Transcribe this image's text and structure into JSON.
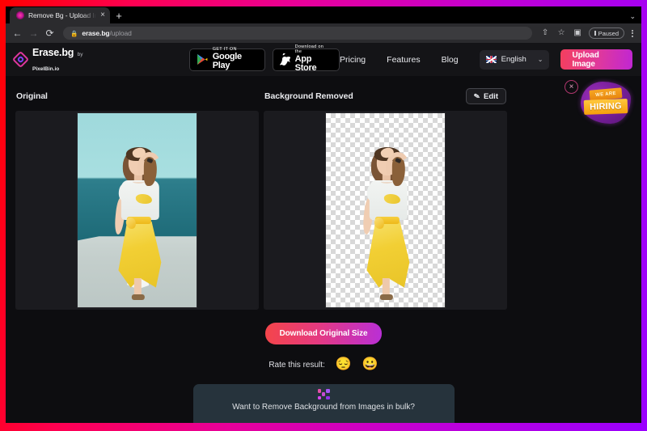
{
  "browser": {
    "tab": {
      "title": "Remove Bg - Upload Images to",
      "close_label": "×"
    },
    "new_tab_label": "+",
    "window_caret": "⌄",
    "back_label": "←",
    "forward_label": "→",
    "reload_label": "⟳",
    "lock_label": "🔒",
    "url_domain": "erase.bg",
    "url_path": "/upload",
    "share_label": "⇧",
    "bookmark_label": "☆",
    "sidepanel_label": "▣",
    "paused_label": "Paused",
    "menu_label": "kebab-menu"
  },
  "header": {
    "logo": {
      "name": "Erase.bg",
      "byline_prefix": "by ",
      "byline_brand": "PixelBin.io"
    },
    "store_badges": [
      {
        "small": "GET IT ON",
        "big": "Google Play",
        "icon": "google-play-icon"
      },
      {
        "small": "Download on the",
        "big": "App Store",
        "icon": "apple-icon"
      }
    ],
    "nav_links": [
      "Pricing",
      "Features",
      "Blog"
    ],
    "language": {
      "value": "English",
      "flag": "uk-flag",
      "chevron": "⌄"
    },
    "upload_button": "Upload Image"
  },
  "promo": {
    "close_label": "×",
    "hiring_top": "WE ARE",
    "hiring_main": "HIRING"
  },
  "panels": [
    {
      "title": "Original",
      "has_edit": false,
      "edit_label": ""
    },
    {
      "title": "Background Removed",
      "has_edit": true,
      "edit_label": "Edit"
    }
  ],
  "actions": {
    "download_label": "Download Original Size",
    "rate_label": "Rate this result:",
    "rate_negative": "😔",
    "rate_positive": "😀"
  },
  "bulk_banner": {
    "text": "Want to Remove Background from Images in bulk?",
    "icon": "bulk-dots-icon"
  },
  "colors": {
    "accent_pink": "#e0399b",
    "accent_purple": "#c026d3",
    "page_bg": "#0d0d10",
    "header_bg": "#141417",
    "stage_bg": "#1b1b1f",
    "banner_bg": "#26333c"
  }
}
